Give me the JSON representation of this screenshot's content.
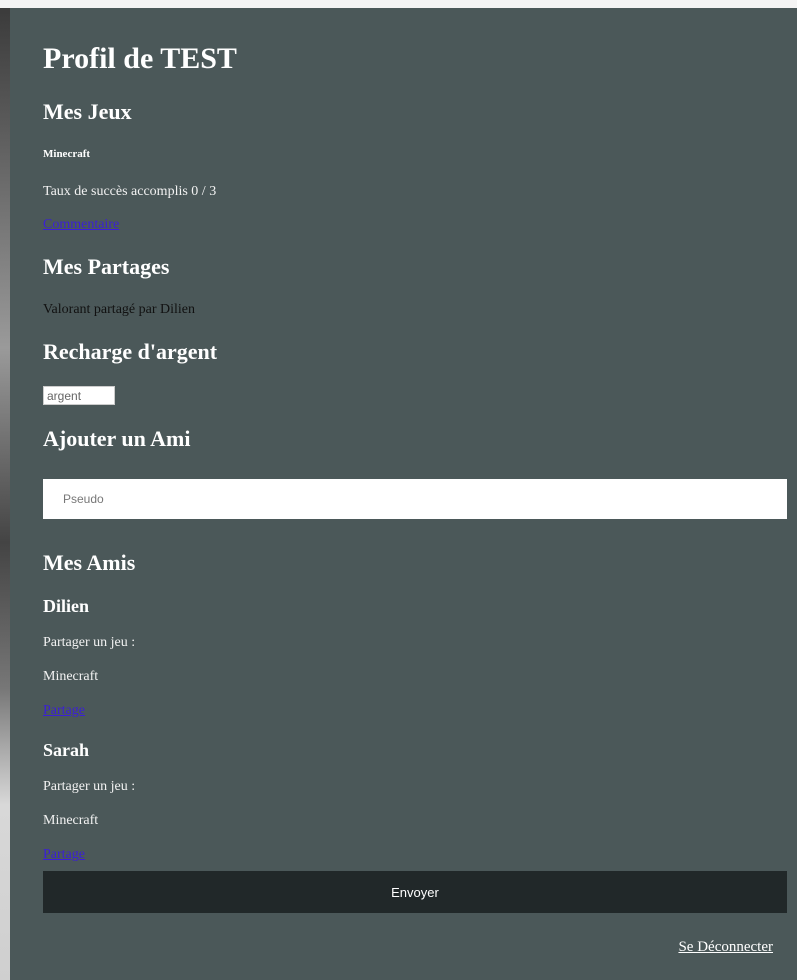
{
  "profile": {
    "title": "Profil de TEST"
  },
  "games": {
    "heading": "Mes Jeux",
    "items": [
      {
        "name": "Minecraft",
        "success_text": "Taux de succès accomplis 0 / 3",
        "comment_link": "Commentaire"
      }
    ]
  },
  "shares": {
    "heading": "Mes Partages",
    "items": [
      "Valorant partagé par Dilien"
    ]
  },
  "recharge": {
    "heading": "Recharge d'argent",
    "placeholder": "argent"
  },
  "add_friend": {
    "heading": "Ajouter un Ami",
    "placeholder": "Pseudo"
  },
  "friends": {
    "heading": "Mes Amis",
    "items": [
      {
        "name": "Dilien",
        "share_label": "Partager un jeu :",
        "game": "Minecraft",
        "share_link": "Partage"
      },
      {
        "name": "Sarah",
        "share_label": "Partager un jeu :",
        "game": "Minecraft",
        "share_link": "Partage"
      }
    ]
  },
  "actions": {
    "send_label": "Envoyer",
    "logout_label": "Se Déconnecter"
  },
  "colors": {
    "panel_bg": "#4b5859",
    "button_bg": "#212829",
    "link": "#3b1fd6"
  }
}
